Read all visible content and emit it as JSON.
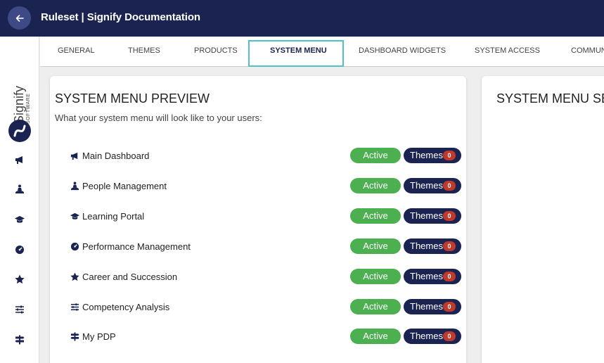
{
  "header": {
    "title": "Ruleset | Signify Documentation",
    "back_icon": "arrow-left-icon"
  },
  "logo": {
    "brand": "Signify",
    "tagline": "SOFTWARE"
  },
  "sidebar": {
    "icons": [
      "megaphone-icon",
      "people-icon",
      "graduation-cap-icon",
      "gauge-icon",
      "star-icon",
      "sliders-icon",
      "signpost-icon"
    ]
  },
  "tabs": [
    {
      "label": "GENERAL"
    },
    {
      "label": "THEMES"
    },
    {
      "label": "PRODUCTS"
    },
    {
      "label": "SYSTEM MENU",
      "active": true
    },
    {
      "label": "DASHBOARD WIDGETS"
    },
    {
      "label": "SYSTEM ACCESS"
    },
    {
      "label": "COMMUN"
    }
  ],
  "preview": {
    "title": "SYSTEM MENU PREVIEW",
    "subtitle": "What your system menu will look like to your users:",
    "items": [
      {
        "label": "Main Dashboard",
        "icon": "megaphone-icon",
        "status": "Active",
        "themes_label": "Themes",
        "themes_count": "0"
      },
      {
        "label": "People Management",
        "icon": "people-icon",
        "status": "Active",
        "themes_label": "Themes",
        "themes_count": "0"
      },
      {
        "label": "Learning Portal",
        "icon": "graduation-cap-icon",
        "status": "Active",
        "themes_label": "Themes",
        "themes_count": "0"
      },
      {
        "label": "Performance Management",
        "icon": "gauge-icon",
        "status": "Active",
        "themes_label": "Themes",
        "themes_count": "0"
      },
      {
        "label": "Career and Succession",
        "icon": "star-icon",
        "status": "Active",
        "themes_label": "Themes",
        "themes_count": "0"
      },
      {
        "label": "Competency Analysis",
        "icon": "sliders-icon",
        "status": "Active",
        "themes_label": "Themes",
        "themes_count": "0"
      },
      {
        "label": "My PDP",
        "icon": "signpost-icon",
        "status": "Active",
        "themes_label": "Themes",
        "themes_count": "0"
      }
    ]
  },
  "settings": {
    "title": "SYSTEM MENU SETTINGS"
  },
  "colors": {
    "navy": "#1b2451",
    "active_green": "#4caf50",
    "badge_red": "#c0392b",
    "tab_highlight": "#4fc2c2"
  }
}
